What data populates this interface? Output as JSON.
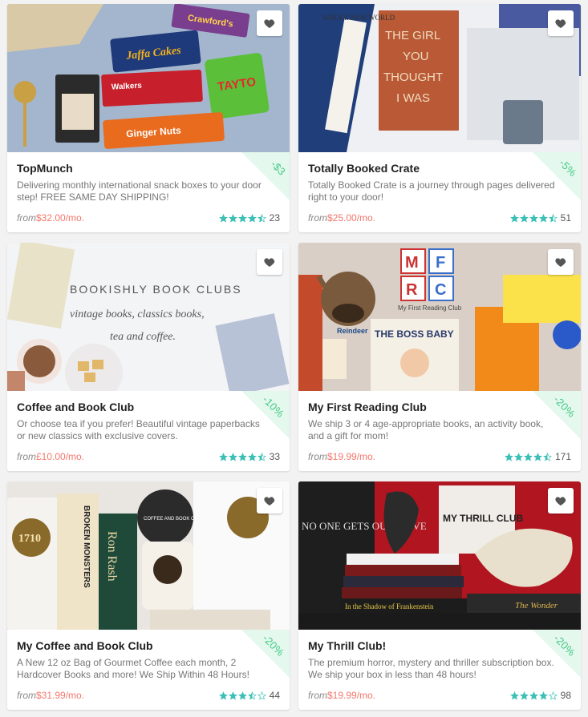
{
  "colors": {
    "accent_price": "#f2766b",
    "star": "#3bbfb6",
    "discount": "#42c983",
    "discount_bg": "#e4f8ee"
  },
  "icons": {
    "favorite": "heart-icon",
    "star": "star-icon"
  },
  "cards": [
    {
      "title": "TopMunch",
      "description": "Delivering monthly international snack boxes to your door step! FREE SAME DAY SHIPPING!",
      "from_label": "from",
      "price": "$32.00",
      "per": "/mo.",
      "discount": "-$3",
      "rating": 4.5,
      "review_count": "23",
      "image_text": [
        "Jaffa Cakes",
        "Walkers",
        "TAYTO",
        "Ginger Nuts",
        "Crawford's"
      ]
    },
    {
      "title": "Totally Booked Crate",
      "description": "Totally Booked Crate is a journey through pages delivered right to your door!",
      "from_label": "from",
      "price": "$25.00",
      "per": "/mo.",
      "discount": "-5%",
      "rating": 4.5,
      "review_count": "51",
      "image_text": [
        "THE GIRL",
        "YOU",
        "THOUGHT",
        "I WAS",
        "WHOLE NEW WORLD"
      ]
    },
    {
      "title": "Coffee and Book Club",
      "description": "Or choose tea if you prefer! Beautiful vintage paperbacks or new classics with exclusive covers.",
      "from_label": "from",
      "price": "£10.00",
      "per": "/mo.",
      "discount": "-10%",
      "rating": 4.5,
      "review_count": "33",
      "image_text": [
        "BOOKISHLY BOOK CLUBS",
        "vintage books, classics books,",
        "tea and coffee."
      ]
    },
    {
      "title": "My First Reading Club",
      "description": "We ship 3 or 4 age-appropriate books, an activity book, and a gift for mom!",
      "from_label": "from",
      "price": "$19.99",
      "per": "/mo.",
      "discount": "-20%",
      "rating": 4.5,
      "review_count": "171",
      "image_text": [
        "M",
        "F",
        "R",
        "C",
        "My First Reading Club",
        "THE BOSS BABY",
        "Reindeer"
      ]
    },
    {
      "title": "My Coffee and Book Club",
      "description": "A New 12 oz Bag of Gourmet Coffee each month, 2 Hardcover Books and more! We Ship Within 48 Hours!",
      "from_label": "from",
      "price": "$31.99",
      "per": "/mo.",
      "discount": "-20%",
      "rating": 3.5,
      "review_count": "44",
      "image_text": [
        "1710",
        "BROKEN MONSTERS",
        "Ron Rash",
        "COFFEE AND BOOK CLUB"
      ]
    },
    {
      "title": "My Thrill Club!",
      "description": "The premium horror, mystery and thriller subscription box. We ship your box in less than 48 hours!",
      "from_label": "from",
      "price": "$19.99",
      "per": "/mo.",
      "discount": "-20%",
      "rating": 4,
      "review_count": "98",
      "image_text": [
        "NO ONE GETS OUT ALIVE",
        "MY THRILL CLUB",
        "In the Shadow of Frankenstein",
        "The Wonder"
      ]
    }
  ]
}
